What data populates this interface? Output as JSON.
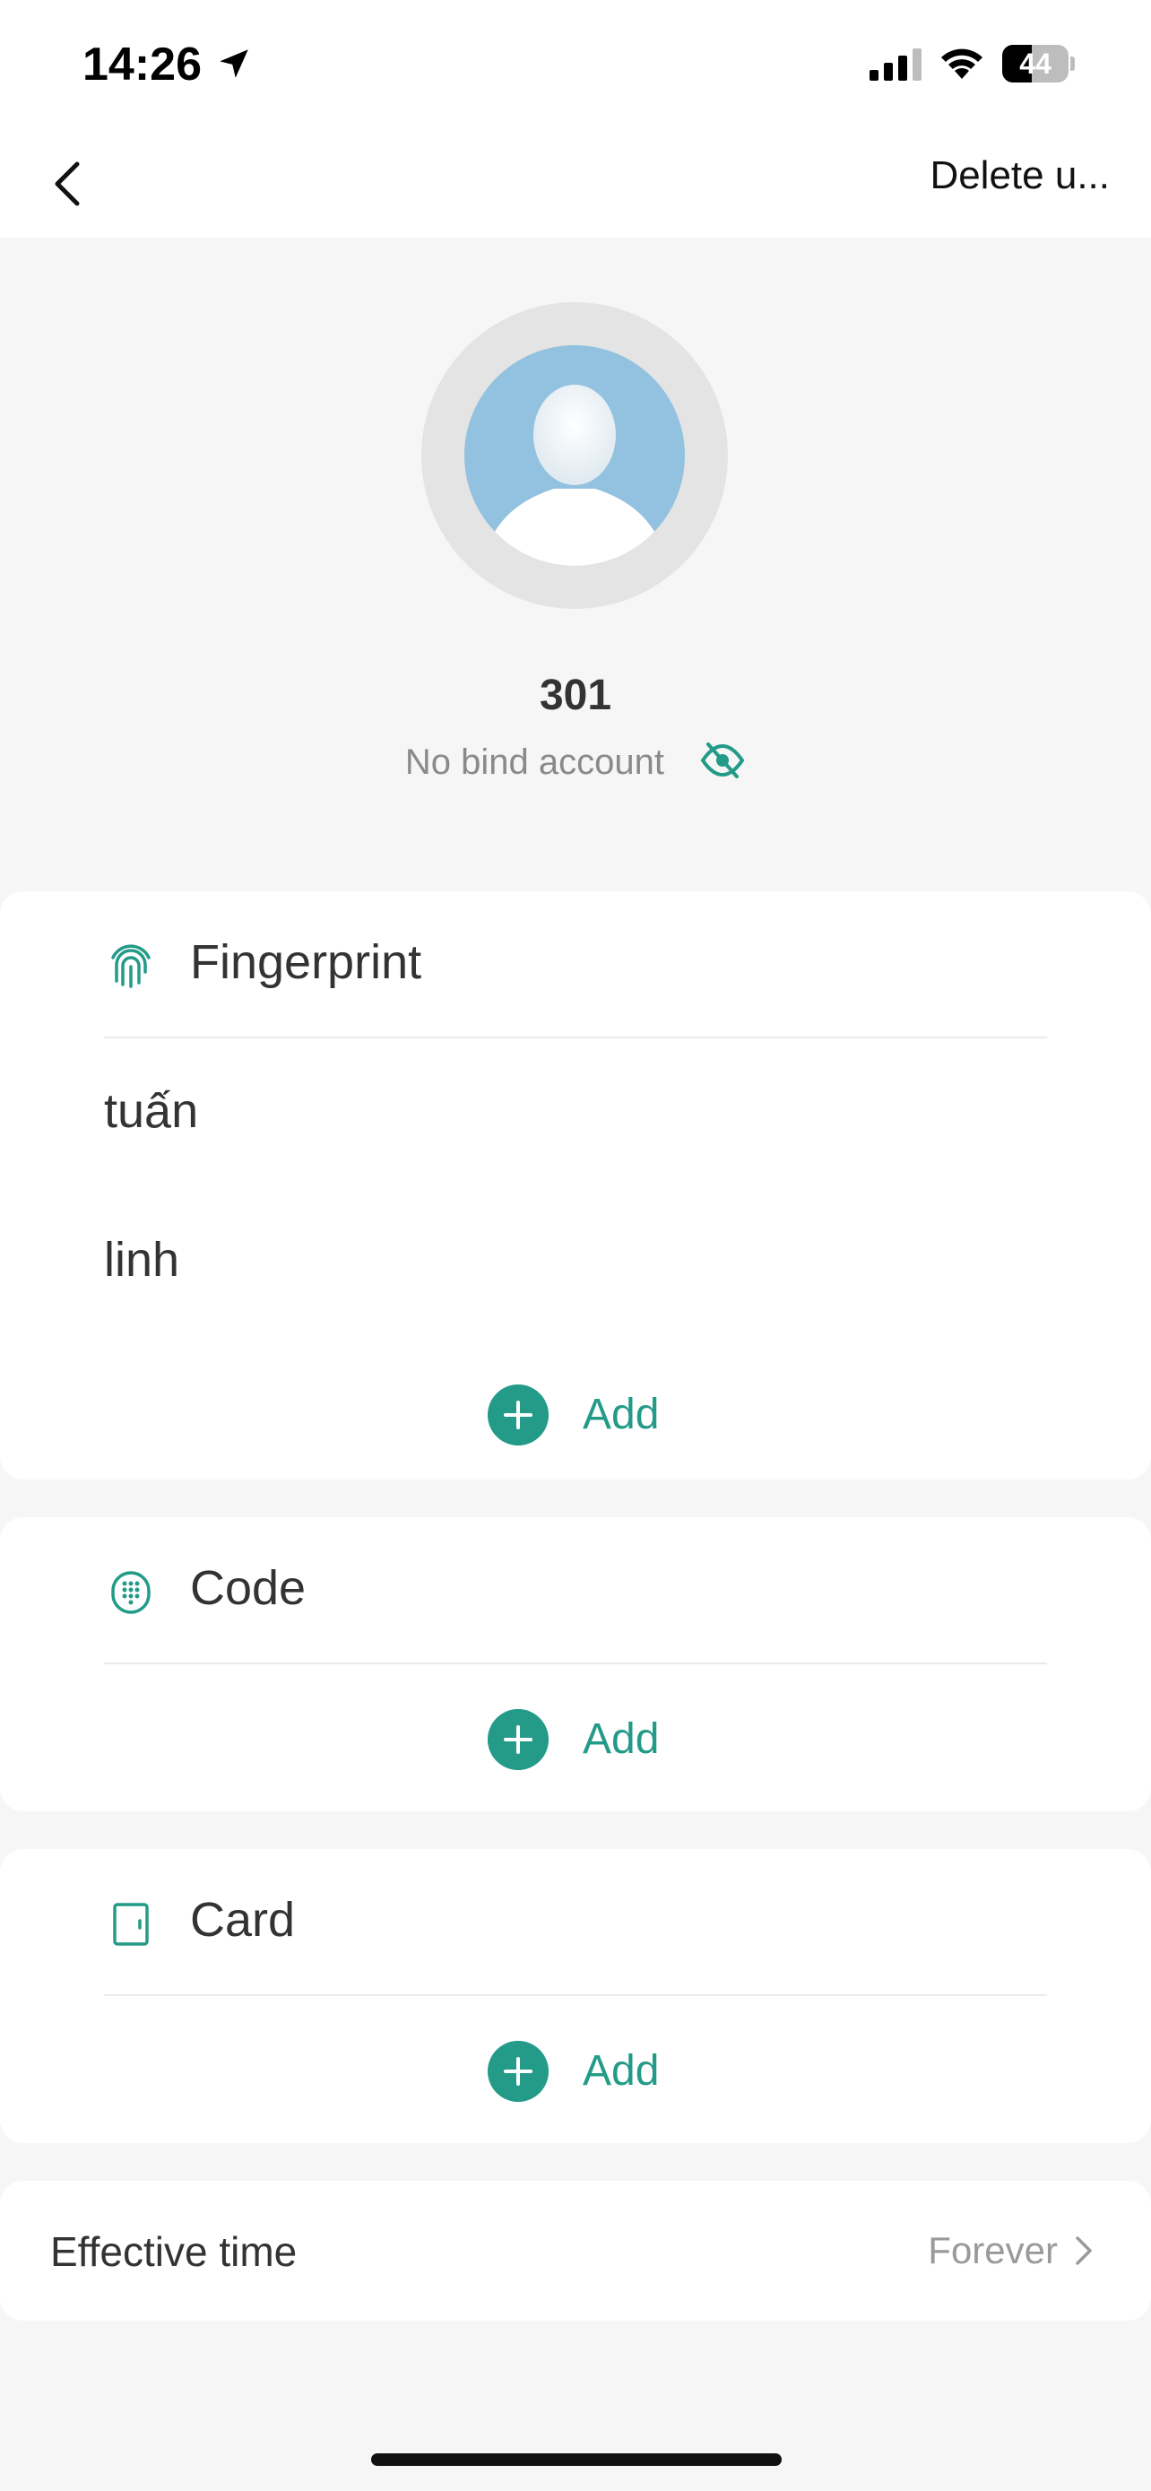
{
  "status_bar": {
    "time": "14:26",
    "battery_level": "44",
    "battery_fraction": 0.44
  },
  "nav": {
    "delete_label": "Delete u..."
  },
  "profile": {
    "name": "301",
    "bind_status": "No bind account"
  },
  "sections": {
    "fingerprint": {
      "title": "Fingerprint",
      "items": [
        "tuấn",
        "linh"
      ],
      "add_label": "Add"
    },
    "code": {
      "title": "Code",
      "add_label": "Add"
    },
    "card": {
      "title": "Card",
      "add_label": "Add"
    }
  },
  "effective_time": {
    "label": "Effective time",
    "value": "Forever"
  },
  "colors": {
    "accent": "#239b88",
    "background": "#f6f6f6",
    "avatar": "#92c2df"
  },
  "icons": [
    "location-icon",
    "signal-icon",
    "wifi-icon",
    "battery-icon",
    "back-icon",
    "eye-off-icon",
    "fingerprint-icon",
    "keypad-icon",
    "card-icon",
    "plus-icon",
    "chevron-right-icon"
  ]
}
